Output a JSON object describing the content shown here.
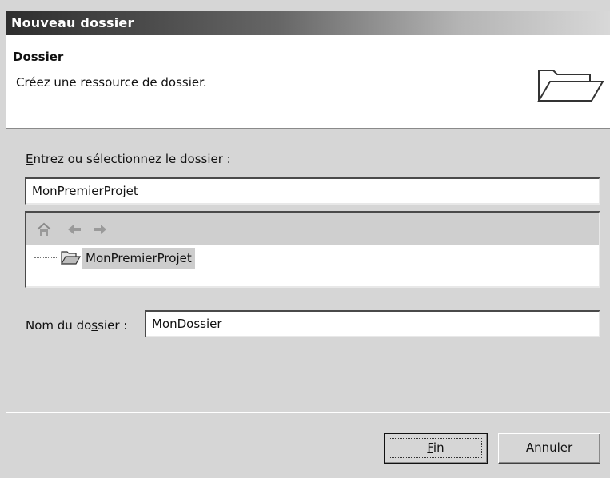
{
  "window": {
    "title": "Nouveau dossier"
  },
  "banner": {
    "title": "Dossier",
    "description": "Créez une ressource de dossier.",
    "icon": "open-folder-icon"
  },
  "folder_selection": {
    "label_mnemonic": "E",
    "label_rest": "ntrez ou sélectionnez le dossier :",
    "path_value": "MonPremierProjet",
    "toolbar_icons": [
      "home-icon",
      "back-arrow-icon",
      "forward-arrow-icon"
    ],
    "tree_items": [
      {
        "label": "MonPremierProjet",
        "icon": "open-folder-icon",
        "selected": true
      }
    ]
  },
  "folder_name": {
    "label_before": "Nom du do",
    "label_mnemonic": "s",
    "label_after": "sier :",
    "value": "MonDossier"
  },
  "buttons": {
    "finish_mnemonic": "F",
    "finish_rest": "in",
    "cancel": "Annuler"
  }
}
